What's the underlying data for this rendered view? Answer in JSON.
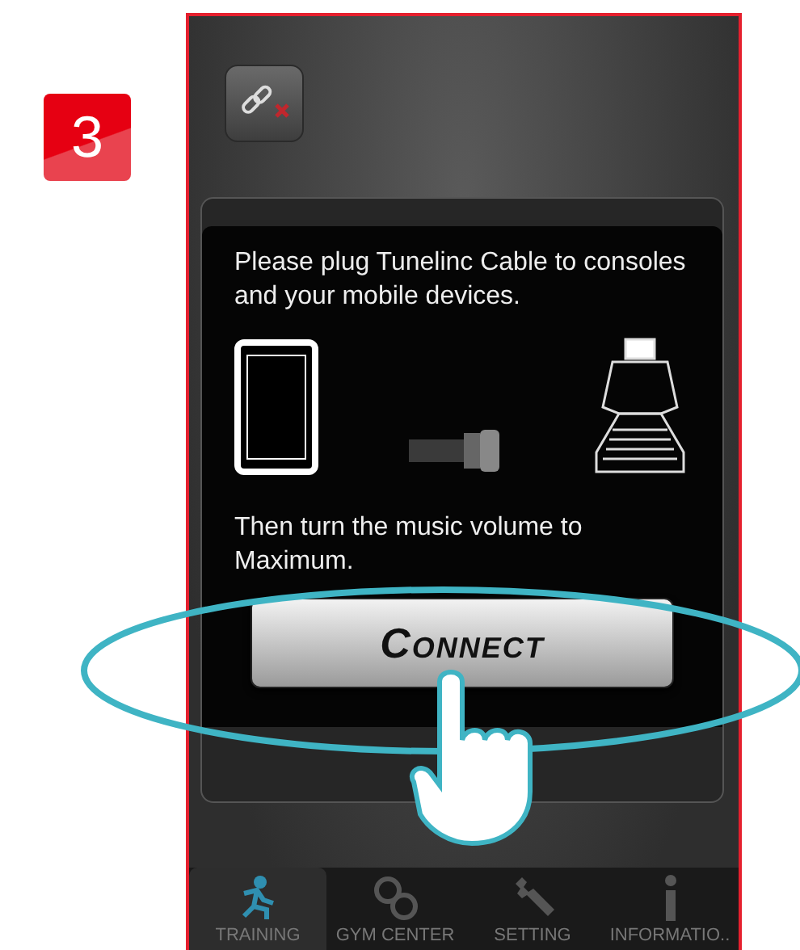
{
  "step_badge": "3",
  "dialog": {
    "message": "Please plug Tunelinc Cable to consoles and your mobile devices.",
    "instruction": "Then turn the music volume to Maximum.",
    "connect_button": "Connect"
  },
  "tabs": [
    {
      "label": "TRAINING",
      "selected": true
    },
    {
      "label": "GYM CENTER",
      "selected": false
    },
    {
      "label": "SETTING",
      "selected": false
    },
    {
      "label": "INFORMATIO..",
      "selected": false
    }
  ]
}
